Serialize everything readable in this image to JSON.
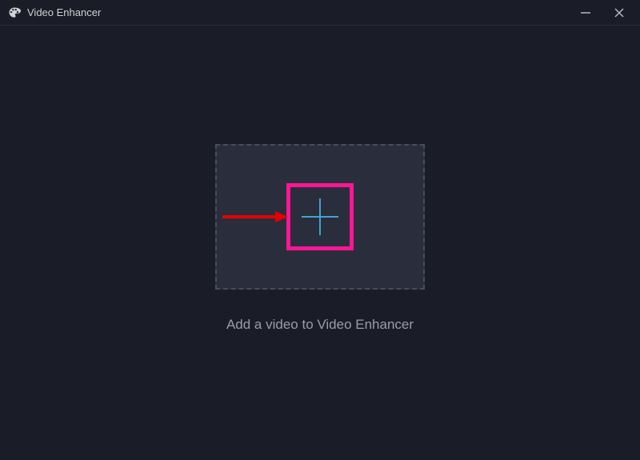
{
  "titlebar": {
    "app_title": "Video Enhancer"
  },
  "main": {
    "instruction_text": "Add a video to Video Enhancer"
  },
  "icons": {
    "app": "palette-icon",
    "minimize": "minimize-icon",
    "close": "close-icon",
    "add": "plus-icon"
  },
  "colors": {
    "background": "#1a1c27",
    "panel": "#2a2d3b",
    "dashed_border": "#4a4d5a",
    "plus_stroke": "#3da8cc",
    "text_muted": "#9c9ca8",
    "annotation_box": "#ff1693",
    "annotation_arrow": "#e60000"
  }
}
